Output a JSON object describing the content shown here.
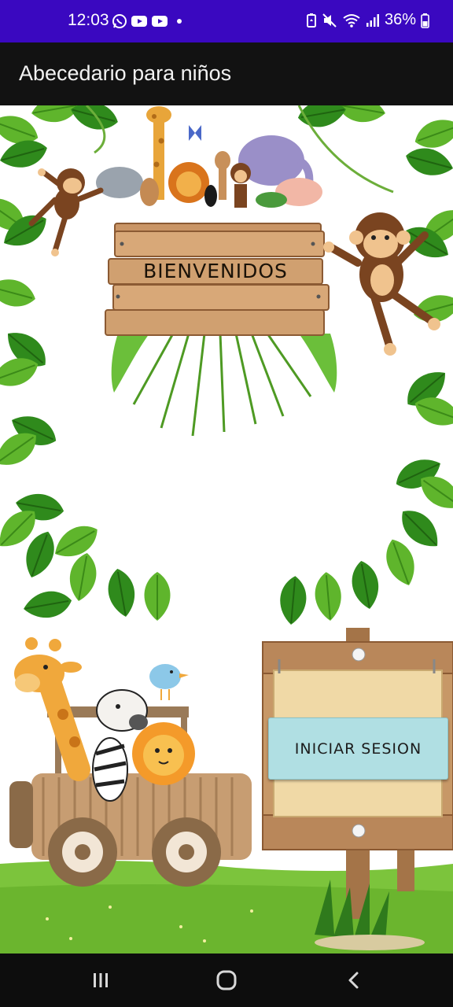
{
  "status_bar": {
    "time": "12:03",
    "battery": "36%",
    "left_icons": [
      "whatsapp-icon",
      "youtube-icon",
      "youtube-icon",
      "dot-icon"
    ],
    "right_icons": [
      "battery-saver-icon",
      "mute-icon",
      "wifi-icon",
      "signal-icon",
      "battery-icon"
    ],
    "background": "#3a08c0"
  },
  "app_bar": {
    "title": "Abecedario para niños",
    "background": "#121212"
  },
  "welcome": {
    "sign_text": "BIENVENIDOS"
  },
  "login": {
    "button_label": "INICIAR SESION",
    "button_color": "#b0dfe3"
  },
  "nav_bar": {
    "buttons": [
      "recent-apps-icon",
      "home-icon",
      "back-icon"
    ]
  }
}
